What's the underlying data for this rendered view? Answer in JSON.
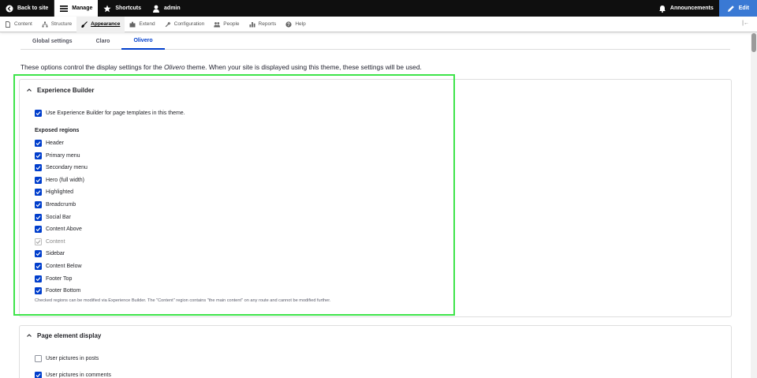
{
  "toolbar": {
    "back_label": "Back to site",
    "manage_label": "Manage",
    "shortcuts_label": "Shortcuts",
    "user_label": "admin",
    "announcements_label": "Announcements",
    "edit_label": "Edit"
  },
  "tray": {
    "items": [
      {
        "label": "Content",
        "icon": "file-icon"
      },
      {
        "label": "Structure",
        "icon": "sitemap-icon"
      },
      {
        "label": "Appearance",
        "icon": "brush-icon"
      },
      {
        "label": "Extend",
        "icon": "puzzle-icon"
      },
      {
        "label": "Configuration",
        "icon": "wrench-icon"
      },
      {
        "label": "People",
        "icon": "people-icon"
      },
      {
        "label": "Reports",
        "icon": "bar-chart-icon"
      },
      {
        "label": "Help",
        "icon": "question-icon"
      }
    ],
    "active": "Appearance",
    "toggle": "|←"
  },
  "tabs": [
    {
      "label": "Global settings"
    },
    {
      "label": "Claro"
    },
    {
      "label": "Olivero"
    }
  ],
  "intro": {
    "before": "These options control the display settings for the ",
    "theme": "Olivero",
    "after": " theme. When your site is displayed using this theme, these settings will be used."
  },
  "xb": {
    "legend": "Experience Builder",
    "use_label": "Use Experience Builder for page templates in this theme.",
    "regions_title": "Exposed regions",
    "regions": [
      {
        "label": "Header",
        "state": "checked"
      },
      {
        "label": "Primary menu",
        "state": "checked"
      },
      {
        "label": "Secondary menu",
        "state": "checked"
      },
      {
        "label": "Hero (full width)",
        "state": "checked"
      },
      {
        "label": "Highlighted",
        "state": "checked"
      },
      {
        "label": "Breadcrumb",
        "state": "checked"
      },
      {
        "label": "Social Bar",
        "state": "checked"
      },
      {
        "label": "Content Above",
        "state": "checked"
      },
      {
        "label": "Content",
        "state": "disabled"
      },
      {
        "label": "Sidebar",
        "state": "checked"
      },
      {
        "label": "Content Below",
        "state": "checked"
      },
      {
        "label": "Footer Top",
        "state": "checked"
      },
      {
        "label": "Footer Bottom",
        "state": "checked"
      }
    ],
    "description": "Checked regions can be modified via Experience Builder. The \"Content\" region contains \"the main content\" on any route and cannot be modified further."
  },
  "page_elements": {
    "legend": "Page element display",
    "items": [
      {
        "label": "User pictures in posts",
        "state": "unchecked"
      },
      {
        "label": "User pictures in comments",
        "state": "checked"
      }
    ]
  },
  "colors": {
    "accent": "#003ecc",
    "highlight": "#3ee44a",
    "toolbar": "#0f0f0f",
    "edit_button": "#3a79d4"
  }
}
